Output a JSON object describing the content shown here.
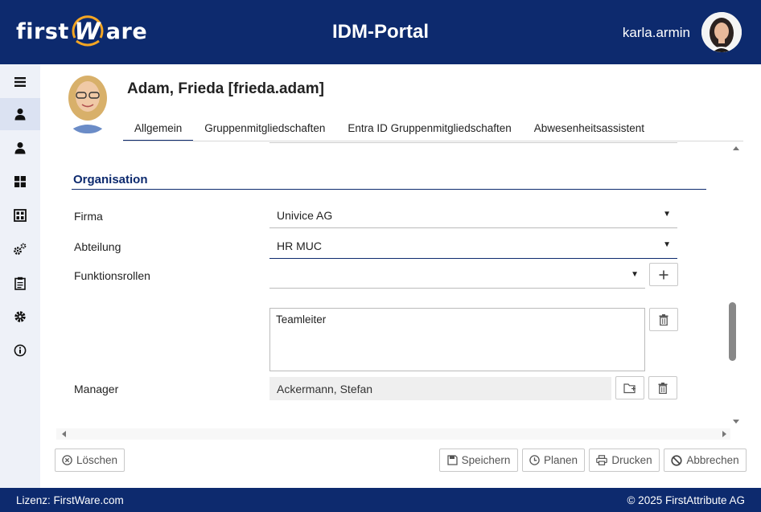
{
  "header": {
    "logo_prefix": "first",
    "logo_w": "W",
    "logo_suffix": "are",
    "app_title": "IDM-Portal",
    "username": "karla.armin",
    "avatar_icon": "user-avatar-photo"
  },
  "sidebar": {
    "items": [
      {
        "icon": "menu-icon"
      },
      {
        "icon": "user-icon"
      },
      {
        "icon": "person-icon"
      },
      {
        "icon": "dashboard-icon"
      },
      {
        "icon": "org-chart-icon"
      },
      {
        "icon": "cogs-icon"
      },
      {
        "icon": "clipboard-icon"
      },
      {
        "icon": "gear-icon"
      },
      {
        "icon": "info-icon"
      }
    ]
  },
  "profile": {
    "name": "Adam, Frieda [frieda.adam]"
  },
  "tabs": [
    {
      "label": "Allgemein",
      "active": true
    },
    {
      "label": "Gruppenmitgliedschaften",
      "active": false
    },
    {
      "label": "Entra ID Gruppenmitgliedschaften",
      "active": false
    },
    {
      "label": "Abwesenheitsassistent",
      "active": false
    }
  ],
  "section": {
    "title": "Organisation"
  },
  "fields": {
    "firma": {
      "label": "Firma",
      "value": "Univice AG"
    },
    "abteilung": {
      "label": "Abteilung",
      "value": "HR MUC"
    },
    "funktionsrollen": {
      "label": "Funktionsrollen",
      "value": "",
      "list_value": "Teamleiter"
    },
    "manager": {
      "label": "Manager",
      "value": "Ackermann, Stefan"
    }
  },
  "actions": {
    "delete": "Löschen",
    "save": "Speichern",
    "schedule": "Planen",
    "print": "Drucken",
    "cancel": "Abbrechen"
  },
  "footer": {
    "license": "Lizenz: FirstWare.com",
    "copyright": "© 2025 FirstAttribute AG"
  },
  "colors": {
    "primary": "#0d2a6e",
    "accent": "#f5a623",
    "sidebar_bg": "#eef1f8"
  }
}
